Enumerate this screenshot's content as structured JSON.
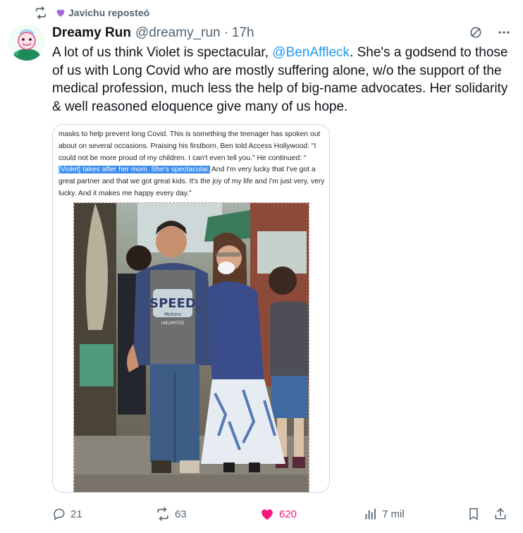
{
  "repost": {
    "user": "Javichu reposteó",
    "icon": "repost-icon",
    "badge_icon": "purple-heart-icon"
  },
  "tweet": {
    "display_name": "Dreamy Run",
    "handle": "@dreamy_run",
    "separator": "·",
    "time": "17h",
    "text_before": "A lot of us think Violet is spectacular, ",
    "mention": "@BenAffleck",
    "text_after": ". She's a godsend to those of us with Long Covid who are mostly suffering alone, w/o the support of the medical profession, much less the help of big-name advocates. Her solidarity & well reasoned eloquence give many of us hope."
  },
  "media": {
    "article_before": "masks to help prevent long Covid. This is something the teenager has spoken out about on several occasions. Praising his firstborn, Ben told Access Hollywood: \"I could not be more proud of my children. I can't even tell you.\" He continued: \"",
    "article_highlight": "[Violet] takes after her mom. She's spectacular.",
    "article_after": " And I'm very lucky that I've got a great partner and that we got great kids. It's the joy of my life and I'm just very, very lucky. And it makes me happy every day.\"",
    "photo_shirt_text": "SPEED",
    "photo_shirt_sub": "Motors",
    "photo_shirt_sub2": "UNLIMITED"
  },
  "actions": {
    "replies": "21",
    "reposts": "63",
    "likes": "620",
    "views": "7 mil"
  },
  "colors": {
    "accent": "#1d9bf0",
    "like": "#f91880",
    "muted": "#536471",
    "highlight": "#3b8cf0"
  }
}
